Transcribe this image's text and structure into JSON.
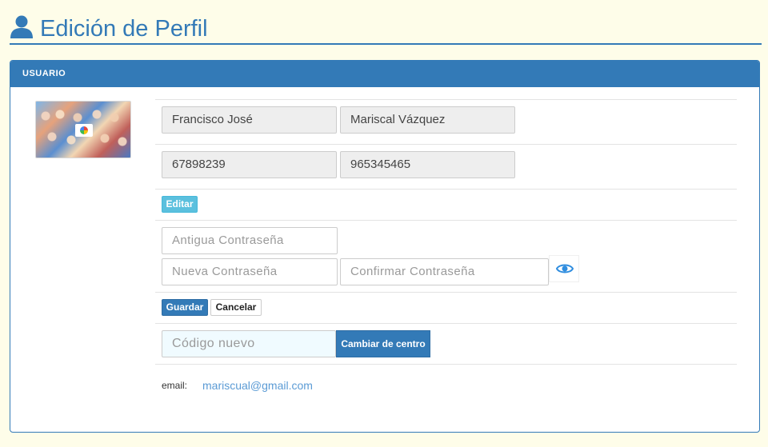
{
  "header": {
    "title": "Edición de Perfil",
    "icon": "user-icon"
  },
  "panel": {
    "heading": "USUARIO"
  },
  "avatar": {
    "icon": "camera-icon"
  },
  "profile": {
    "first_name": "Francisco José",
    "last_name": "Mariscal Vázquez",
    "phone_1": "67898239",
    "phone_2": "965345465"
  },
  "actions": {
    "edit_label": "Editar",
    "save_label": "Guardar",
    "cancel_label": "Cancelar",
    "change_center_label": "Cambiar de centro"
  },
  "password": {
    "old_placeholder": "Antigua Contraseña",
    "new_placeholder": "Nueva Contraseña",
    "confirm_placeholder": "Confirmar Contraseña",
    "toggle_icon": "eye-icon"
  },
  "center": {
    "code_placeholder": "Código nuevo"
  },
  "email": {
    "label": "email:",
    "value": "mariscual@gmail.com"
  },
  "colors": {
    "primary": "#337ab7",
    "info": "#5bc0de",
    "page_background": "#fefde9",
    "link": "#5b9bd5"
  }
}
